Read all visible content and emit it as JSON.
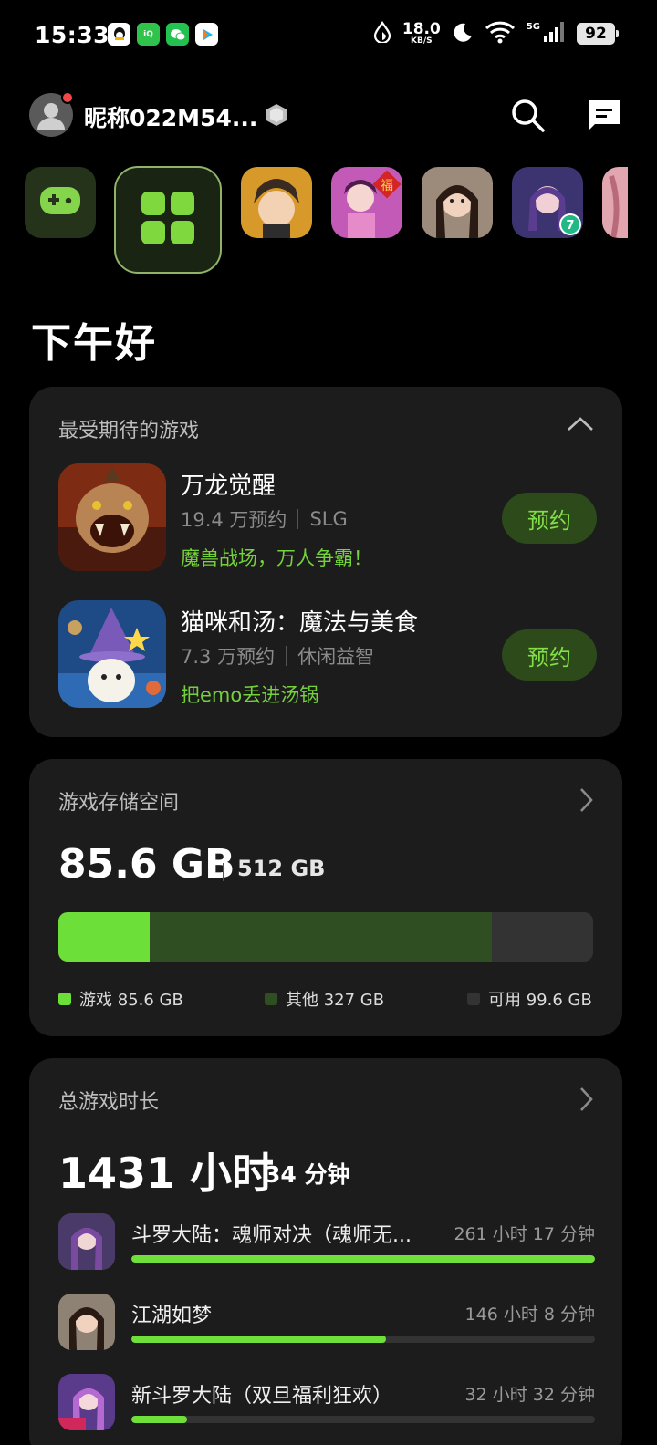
{
  "status_bar": {
    "time": "15:33",
    "net_speed_value": "18.0",
    "net_speed_unit": "KB/S",
    "network_type": "5G",
    "battery": "92",
    "notification_apps": [
      "qq-icon",
      "iqiyi-icon",
      "wechat-icon",
      "video-app-icon"
    ]
  },
  "header": {
    "nickname": "昵称022M54..."
  },
  "game_strip": {
    "shortcuts": [
      "gamepad-icon",
      "all-games-icon"
    ],
    "games": [
      "game-icon-1",
      "game-icon-2",
      "game-icon-3",
      "game-icon-4",
      "game-icon-5"
    ],
    "badge_5": "7"
  },
  "greeting": "下午好",
  "expected_games": {
    "title": "最受期待的游戏",
    "items": [
      {
        "name": "万龙觉醒",
        "reservations": "19.4 万预约",
        "genre": "SLG",
        "slogan": "魔兽战场，万人争霸！",
        "button": "预约"
      },
      {
        "name": "猫咪和汤：魔法与美食",
        "reservations": "7.3 万预约",
        "genre": "休闲益智",
        "slogan": "把emo丢进汤锅",
        "button": "预约"
      }
    ]
  },
  "storage": {
    "title": "游戏存储空间",
    "used": "85.6 GB",
    "total": "512 GB",
    "segments_fraction": {
      "games": 0.17,
      "other": 0.64,
      "free": 0.19
    },
    "legend": [
      {
        "label": "游戏 85.6 GB",
        "color": "#6ce038"
      },
      {
        "label": "其他 327 GB",
        "color": "#2f4f22"
      },
      {
        "label": "可用 99.6 GB",
        "color": "#333333"
      }
    ]
  },
  "play_time": {
    "title": "总游戏时长",
    "hours": "1431 小时",
    "minutes": "34 分钟",
    "items": [
      {
        "name": "斗罗大陆：魂师对决（魂师无...",
        "duration": "261 小时 17 分钟",
        "fraction": 1.0
      },
      {
        "name": "江湖如梦",
        "duration": "146 小时 8 分钟",
        "fraction": 0.55
      },
      {
        "name": "新斗罗大陆（双旦福利狂欢）",
        "duration": "32 小时 32 分钟",
        "fraction": 0.12
      }
    ]
  },
  "colors": {
    "accent": "#6fe03a",
    "card_bg": "#1c1c1c",
    "button_bg": "#2d4a1b"
  }
}
